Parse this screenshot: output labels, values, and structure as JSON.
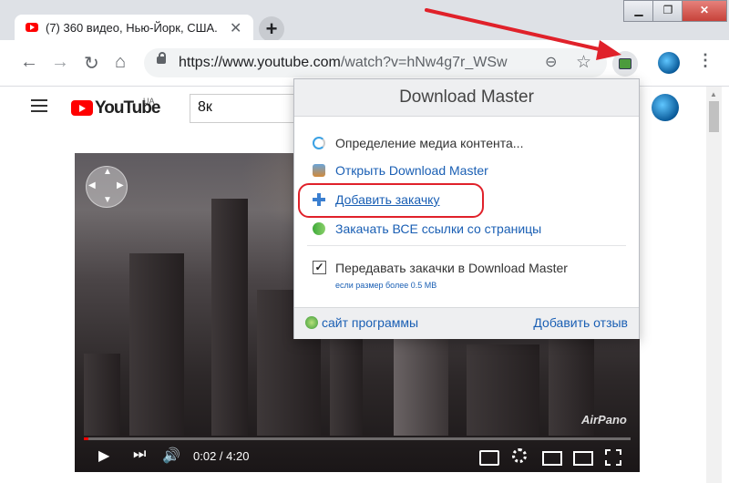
{
  "tab": {
    "title": "(7) 360 видео, Нью-Йорк, США.",
    "close": "✕"
  },
  "newtab": {
    "label": "+"
  },
  "window_controls": {
    "minimize": "▁",
    "maximize": "❐",
    "close": "✕"
  },
  "toolbar": {
    "back": "←",
    "forward": "→",
    "reload": "↻",
    "home": "⌂",
    "url_host": "https://www.youtube.com",
    "url_path": "/watch?v=hNw4g7r_WSw",
    "zoom": "⊖",
    "star": "☆",
    "menu": "⋮"
  },
  "youtube": {
    "logo_text": "YouTube",
    "region": "UA",
    "search_value": "8к"
  },
  "video": {
    "watermark": "AirPano",
    "time": "0:02 / 4:20",
    "progress": 0.008,
    "controls": {
      "play": "▶",
      "next": "⏭",
      "volume": "🔊"
    }
  },
  "download_master": {
    "title": "Download Master",
    "detect_label": "Определение медиа контента...",
    "open_label": "Открыть Download Master",
    "add_label": "Добавить закачку",
    "download_all_label": "Закачать ВСЕ ссылки со страницы",
    "pass_label": "Передавать закачки в Download Master",
    "pass_checked": true,
    "size_note": "если размер более 0.5 МВ",
    "site_link": "сайт программы",
    "review_link": "Добавить отзыв"
  },
  "colors": {
    "accent_red": "#e0212a",
    "link_blue": "#1a5fb4",
    "youtube_red": "#ff0000"
  }
}
